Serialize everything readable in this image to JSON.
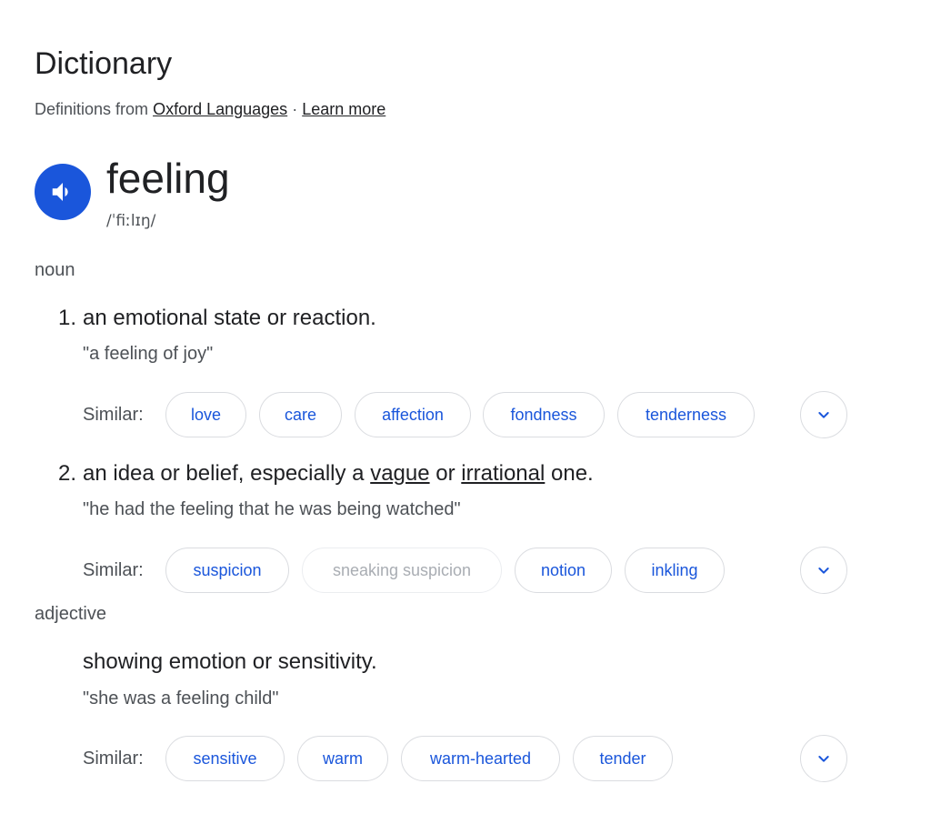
{
  "header": {
    "title": "Dictionary",
    "source_prefix": "Definitions from",
    "source_link": "Oxford Languages",
    "separator": "·",
    "learn_more": "Learn more"
  },
  "entry": {
    "word": "feeling",
    "phonetic": "/ˈfiːlɪŋ/",
    "speaker_icon": "speaker-icon"
  },
  "noun": {
    "pos": "noun",
    "senses": [
      {
        "number": "1.",
        "definition": "an emotional state or reaction.",
        "example": "\"a feeling of joy\"",
        "similar_label": "Similar:",
        "similar": [
          "love",
          "care",
          "affection",
          "fondness",
          "tenderness"
        ]
      },
      {
        "number": "2.",
        "definition_parts": [
          "an idea or belief, especially a",
          "vague",
          "or",
          "irrational",
          "one."
        ],
        "example": "\"he had the feeling that he was being watched\"",
        "similar_label": "Similar:",
        "similar": [
          "suspicion",
          "sneaking suspicion",
          "notion",
          "inkling"
        ]
      }
    ]
  },
  "adjective": {
    "pos": "adjective",
    "senses": [
      {
        "definition": "showing emotion or sensitivity.",
        "example": "\"she was a feeling child\"",
        "similar_label": "Similar:",
        "similar": [
          "sensitive",
          "warm",
          "warm-hearted",
          "tender"
        ]
      }
    ]
  },
  "colors": {
    "accent": "#1a56db",
    "chip_border": "#dadce0",
    "disabled_text": "#a9adb3",
    "muted_text": "#4d5156"
  },
  "icons": {
    "expand": "chevron-down-icon",
    "audio": "speaker-icon"
  }
}
